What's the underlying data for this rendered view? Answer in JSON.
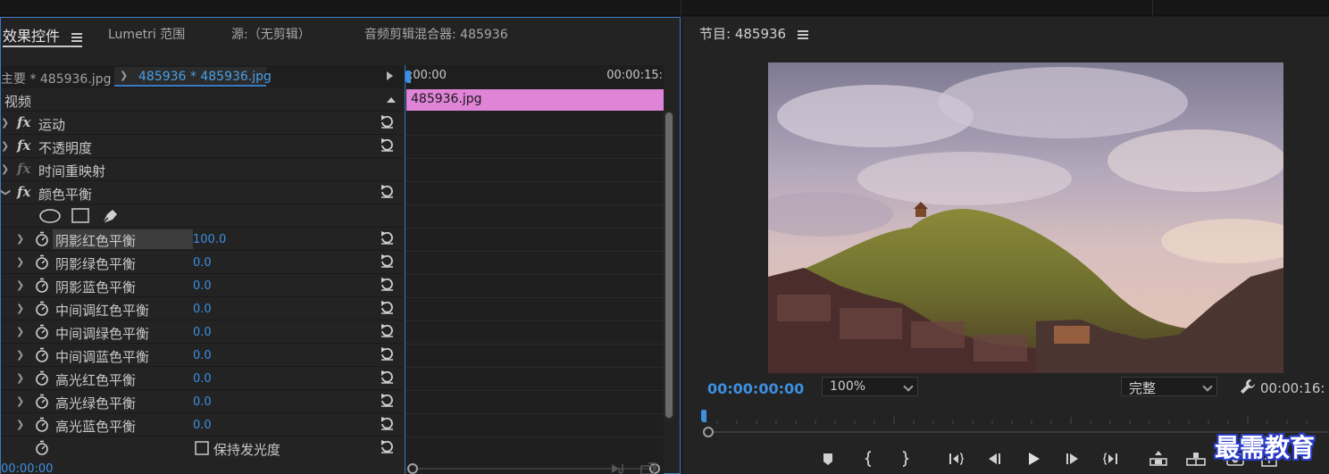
{
  "effect_controls": {
    "tabs": [
      {
        "label": "效果控件"
      },
      {
        "label": "Lumetri 范围"
      },
      {
        "label": "源:（无剪辑）"
      },
      {
        "label": "音频剪辑混合器: 485936"
      }
    ],
    "master_label": "主要 * 485936.jpg",
    "clip_selector": "485936 * 485936.jpg",
    "section": "视频",
    "effects": [
      {
        "name": "运动"
      },
      {
        "name": "不透明度"
      },
      {
        "name": "时间重映射"
      },
      {
        "name": "颜色平衡"
      }
    ],
    "params": [
      {
        "name": "阴影红色平衡",
        "value": "100.0"
      },
      {
        "name": "阴影绿色平衡",
        "value": "0.0"
      },
      {
        "name": "阴影蓝色平衡",
        "value": "0.0"
      },
      {
        "name": "中间调红色平衡",
        "value": "0.0"
      },
      {
        "name": "中间调绿色平衡",
        "value": "0.0"
      },
      {
        "name": "中间调蓝色平衡",
        "value": "0.0"
      },
      {
        "name": "高光红色平衡",
        "value": "0.0"
      },
      {
        "name": "高光绿色平衡",
        "value": "0.0"
      },
      {
        "name": "高光蓝色平衡",
        "value": "0.0"
      }
    ],
    "preserve_luminosity": "保持发光度",
    "timeline_start": ":00:00",
    "timeline_end": "00:00:15:",
    "clip_name": "485936.jpg",
    "current_time": "00:00:00"
  },
  "program": {
    "title": "节目: 485936",
    "timecode": "00:00:00:00",
    "zoom": "100%",
    "quality": "完整",
    "duration": "00:00:16:"
  },
  "watermark": "最需教育",
  "colors": {
    "accent": "#3d8fe0",
    "clip": "#e084d8"
  }
}
